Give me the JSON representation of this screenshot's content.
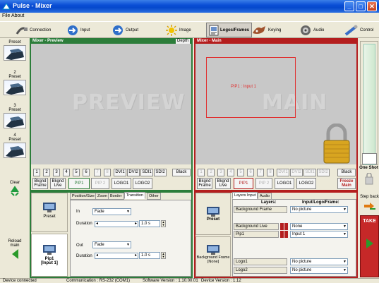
{
  "window": {
    "title": "Pulse - Mixer",
    "controls": [
      "_",
      "□",
      "✕"
    ]
  },
  "menu": {
    "items": [
      "File",
      "About"
    ]
  },
  "toolbar": {
    "buttons": [
      {
        "label": "Connection"
      },
      {
        "label": "Input"
      },
      {
        "label": "Output"
      },
      {
        "label": "Image"
      },
      {
        "label": "Logos/Frames"
      },
      {
        "label": "Keying"
      },
      {
        "label": "Audio"
      },
      {
        "label": "Control"
      }
    ]
  },
  "presets": [
    {
      "title": "Preset"
    },
    {
      "number": "2",
      "title": "Preset"
    },
    {
      "number": "3",
      "title": "Preset"
    },
    {
      "number": "4",
      "title": "Preset"
    }
  ],
  "left_actions": {
    "clear": "Clear",
    "reload": "Reload\nmain"
  },
  "preview": {
    "header": "Mixer - Preview",
    "depth": "Depth",
    "watermark": "PREVIEW"
  },
  "main": {
    "header": "Mixer - Main",
    "watermark": "MAIN",
    "pip_label": "PiP1 : Input 1"
  },
  "preview_inputs": {
    "numbers": [
      "1",
      "2",
      "3",
      "4",
      "5",
      "6",
      "7",
      "8"
    ],
    "dvi": [
      "DVI1",
      "DVI2",
      "SDI1",
      "SDI2"
    ],
    "black": "Black"
  },
  "main_inputs": {
    "numbers": [
      "1",
      "2",
      "3",
      "4",
      "5",
      "6",
      "7",
      "8"
    ],
    "dvi": [
      "DVI1",
      "DVI2",
      "SDI1",
      "SDI2"
    ],
    "black": "Black",
    "freeze": "Freeze\nMain"
  },
  "preview_layers": {
    "bkgnd_frame": "Bkgnd\nFrame",
    "bkgnd_live": "Bkgnd\nLive",
    "pip1": "PIP1",
    "pip2": "PIP 2",
    "logo1": "LOGO1",
    "logo2": "LOGO2"
  },
  "main_layers": {
    "bkgnd_frame": "Bkgnd\nFrame",
    "bkgnd_live": "Bkgnd\nLive",
    "pip1": "PIP1",
    "pip2": "PIP 2",
    "logo1": "LOGO1",
    "logo2": "LOGO2"
  },
  "right_controls": {
    "one_shot": "One Shot",
    "step_back": "Step back",
    "take": "TAKE"
  },
  "pip_panel": {
    "preset_label": "Preset",
    "pip_label": "Pip1\n[Input 1]",
    "tabs": [
      "Position/Size",
      "Zoom",
      "Border",
      "Transition",
      "Other"
    ],
    "selected_tab": "Transition",
    "in_label": "In",
    "in_value": "Fade",
    "in_duration_label": "Duration",
    "in_duration_value": "1.0 s",
    "out_label": "Out",
    "out_value": "Fade",
    "out_duration_label": "Duration",
    "out_duration_value": "1.0 s"
  },
  "layers_panel": {
    "preset_label": "Preset",
    "bg_label": "Background Frame\n[None]",
    "tabs": [
      "Layers Input",
      "Audio"
    ],
    "col_layers": "Layers:",
    "col_input": "Input/Logo/Frame:",
    "rows": [
      {
        "layer": "Background Frame",
        "value": "No picture"
      },
      {
        "layer": "Background Live",
        "value": "None"
      },
      {
        "layer": "Pip1",
        "value": "Input 1"
      },
      {
        "layer": "Logo1",
        "value": "No picture"
      },
      {
        "layer": "Logo2",
        "value": "No picture"
      }
    ]
  },
  "status": {
    "connection": "Device connected",
    "communication": "Communication : RS-232 (COM1)",
    "software": "Software Version : 1.10.00.01",
    "device": "Device Version : 1.12"
  },
  "colors": {
    "preview_green": "#2c7d3a",
    "main_red": "#b41e1e",
    "xp_blue": "#0a4ed6"
  }
}
